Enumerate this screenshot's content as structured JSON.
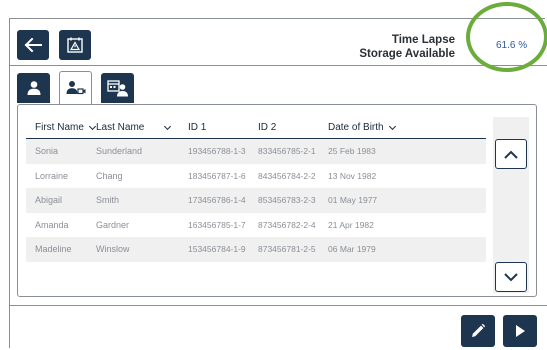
{
  "storage": {
    "label_line1": "Time Lapse",
    "label_line2": "Storage Available",
    "value": "61.6 %"
  },
  "table": {
    "columns": [
      "First Name",
      "Last Name",
      "ID 1",
      "ID 2",
      "Date of Birth"
    ],
    "rows": [
      {
        "first": "Sonia",
        "last": "Sunderland",
        "id1": "193456788-1-3",
        "id2": "833456785-2-1",
        "dob": "25 Feb 1983"
      },
      {
        "first": "Lorraine",
        "last": "Chang",
        "id1": "183456787-1-6",
        "id2": "843456784-2-2",
        "dob": "13 Nov 1982"
      },
      {
        "first": "Abigail",
        "last": "Smith",
        "id1": "173456786-1-4",
        "id2": "853456783-2-3",
        "dob": "01 May 1977"
      },
      {
        "first": "Amanda",
        "last": "Gardner",
        "id1": "163456785-1-7",
        "id2": "873456782-2-4",
        "dob": "21 Apr 1982"
      },
      {
        "first": "Madeline",
        "last": "Winslow",
        "id1": "153456784-1-9",
        "id2": "873456781-2-5",
        "dob": "06 Mar 1979"
      }
    ]
  },
  "icons": {
    "back": "arrow-left-icon",
    "timelapse": "timelapse-warning-icon",
    "tab1": "person-icon",
    "tab2": "person-camera-icon",
    "tab3": "calendar-person-icon",
    "edit": "pencil-icon",
    "next": "play-icon",
    "scroll_up": "chevron-up-icon",
    "scroll_down": "chevron-down-icon"
  },
  "colors": {
    "primary": "#1e3550",
    "accent_ring": "#6aad3d",
    "value_text": "#2e5a9a"
  }
}
